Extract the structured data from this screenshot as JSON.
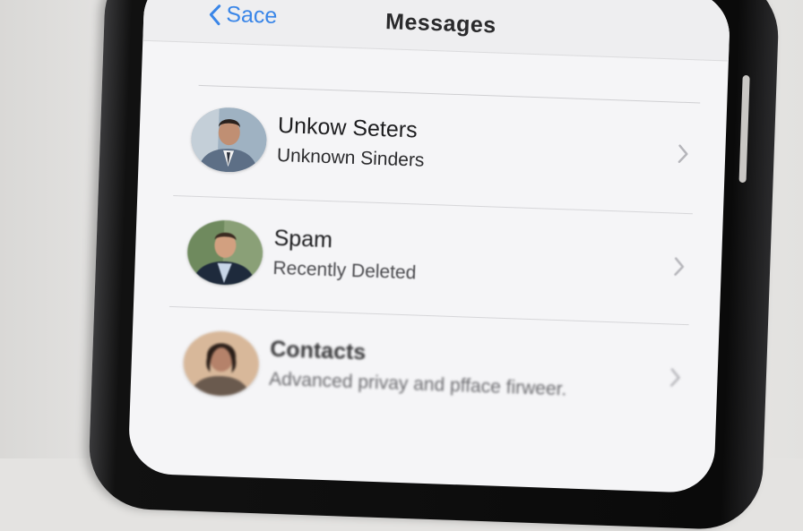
{
  "nav": {
    "back_label": "Sace",
    "title": "Messages",
    "back_icon": "chevron-left-icon"
  },
  "rows": [
    {
      "title": "Unkow Seters",
      "subtitle": "Unknown Sinders",
      "avatar": "person-avatar"
    },
    {
      "title": "Spam",
      "subtitle": "Recently Deleted",
      "avatar": "person-avatar"
    },
    {
      "title": "Contacts",
      "subtitle": "Advanced privay and pfface firweer.",
      "avatar": "person-avatar"
    }
  ],
  "colors": {
    "accent": "#3a86e8",
    "screen_bg": "#f5f5f7",
    "nav_bg": "#eeeef0",
    "chevron": "#b5b5ba"
  }
}
